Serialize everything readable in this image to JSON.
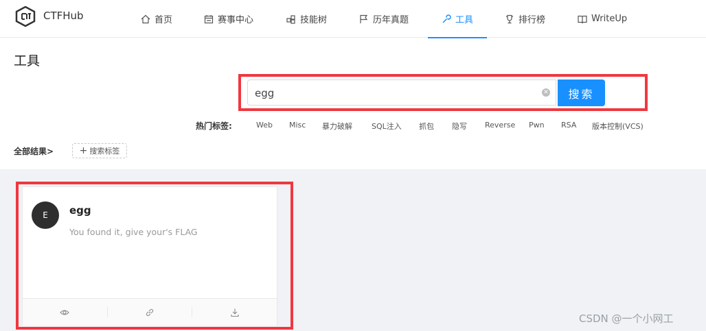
{
  "header": {
    "brand": "CTFHub",
    "nav": [
      {
        "label": "首页",
        "icon": "home-icon"
      },
      {
        "label": "赛事中心",
        "icon": "calendar-icon"
      },
      {
        "label": "技能树",
        "icon": "tree-icon"
      },
      {
        "label": "历年真题",
        "icon": "flag-icon"
      },
      {
        "label": "工具",
        "icon": "wrench-icon",
        "active": true
      },
      {
        "label": "排行榜",
        "icon": "trophy-icon"
      },
      {
        "label": "WriteUp",
        "icon": "book-icon"
      }
    ]
  },
  "page": {
    "title": "工具"
  },
  "search": {
    "value": "egg",
    "button_label": "搜索"
  },
  "hot_tags": {
    "label": "热门标签:",
    "items": [
      "Web",
      "Misc",
      "暴力破解",
      "SQL注入",
      "抓包",
      "隐写",
      "Reverse",
      "Pwn",
      "RSA",
      "版本控制(VCS)"
    ]
  },
  "filters": {
    "all_results": "全部结果>",
    "add_tag": "搜索标签"
  },
  "results": [
    {
      "avatar_letter": "E",
      "title": "egg",
      "description": "You found it, give your's FLAG"
    }
  ],
  "watermark": "CSDN @一个小网工",
  "colors": {
    "accent": "#1890ff",
    "highlight_box": "#f0373f",
    "content_bg": "#f0f2f5"
  }
}
